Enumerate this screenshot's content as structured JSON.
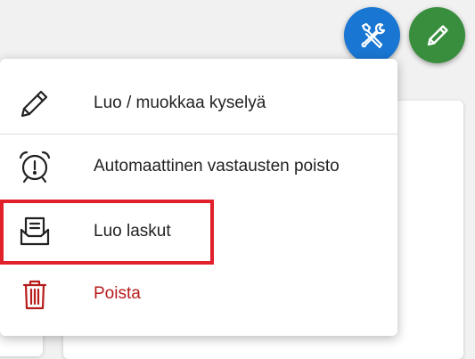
{
  "toolbar": {
    "tools_button_icon": "wrench-screwdriver-icon",
    "edit_button_icon": "pencil-icon",
    "tools_color": "#1976d2",
    "edit_color": "#388e3c"
  },
  "menu": {
    "items": [
      {
        "label": "Luo / muokkaa kyselyä",
        "icon": "pencil-outline-icon"
      },
      {
        "label": "Automaattinen vastausten poisto",
        "icon": "alarm-clock-icon"
      },
      {
        "label": "Luo laskut",
        "icon": "invoice-tray-icon"
      },
      {
        "label": "Poista",
        "icon": "trash-icon",
        "color": "#b71c1c"
      }
    ]
  },
  "highlight_color": "#e0202a"
}
